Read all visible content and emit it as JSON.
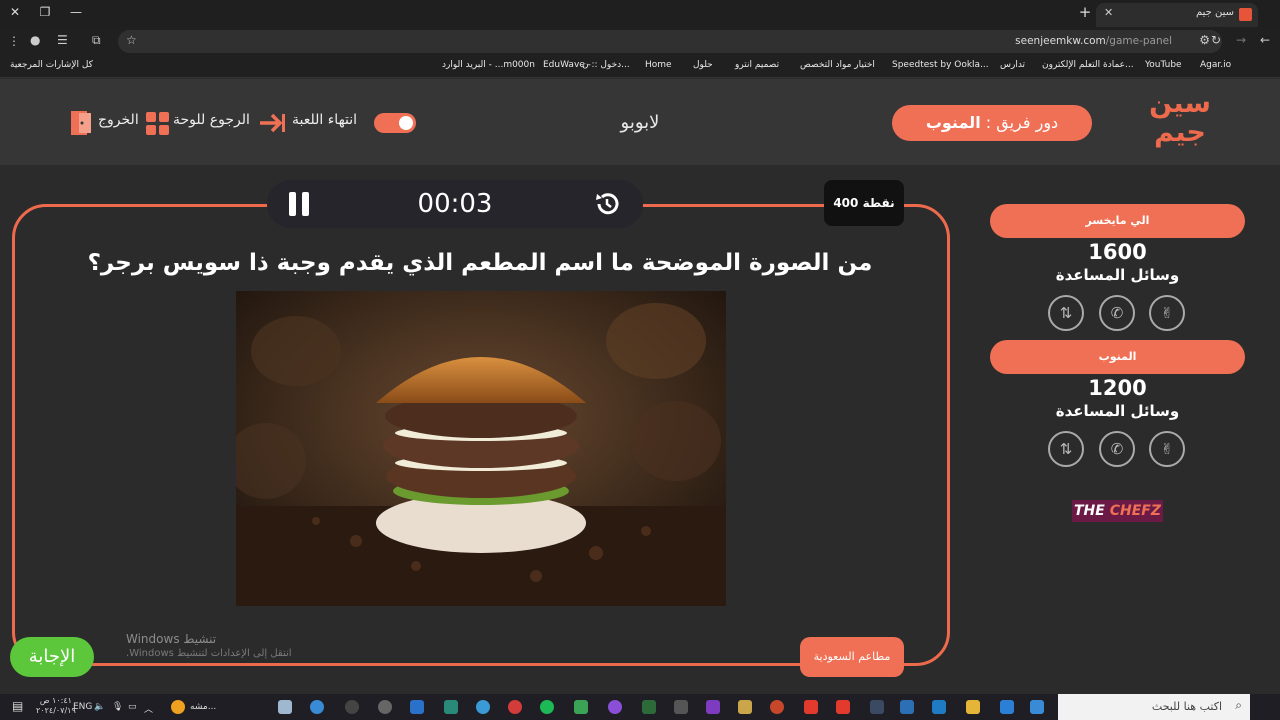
{
  "browser": {
    "tab_title": "سين جيم",
    "url_domain": "seenjeemkw.com",
    "url_path": "/game-panel",
    "bookmarks": [
      "Agar.io",
      "YouTube",
      "عمادة التعلم الإلكترون...",
      "تدارس",
      "Speedtest by Ookla...",
      "اختيار مواد التخصص",
      "تصميم انترو",
      "حلول",
      "Home",
      "دخول :: ن...",
      "EduWave -",
      "البريد الوارد - ...m000n",
      "كل الإشارات المرجعية"
    ]
  },
  "header": {
    "logo_line1": "سين",
    "logo_line2": "جيم",
    "turn_prefix": "دور فريق :",
    "turn_team": "المنوب",
    "current_team_name": "لابوبو",
    "end_game_label": "انتهاء اللعبة",
    "back_to_board_label": "الرجوع للوحة",
    "exit_label": "الخروج"
  },
  "game": {
    "timer": "00:03",
    "points": "400 نقطة",
    "question": "من الصورة الموضحة ما اسم المطعم الذي يقدم وجبة ذا سويس برجر؟",
    "category": "مطاعم السعودية",
    "answer_label": "الإجابة"
  },
  "teams": [
    {
      "name": "الي مايخسر",
      "score": "1600",
      "helpers_label": "وسائل المساعدة"
    },
    {
      "name": "المنوب",
      "score": "1200",
      "helpers_label": "وسائل المساعدة"
    }
  ],
  "sponsor": {
    "part1": "THE ",
    "part2": "CHEFZ"
  },
  "watermark": {
    "title": "تنشيط Windows",
    "subtitle": "انتقل إلى الإعدادات لتنشيط Windows."
  },
  "taskbar": {
    "search_placeholder": "اكتب هنا للبحث",
    "lang": "ENG",
    "time": "١٠:٤١ ص",
    "date": "٢٠٢٤/٠٧/١٩",
    "app_label": "مشه..."
  },
  "colors": {
    "accent": "#f07055",
    "answer_green": "#5cc73b",
    "background": "#2b2b2b"
  }
}
